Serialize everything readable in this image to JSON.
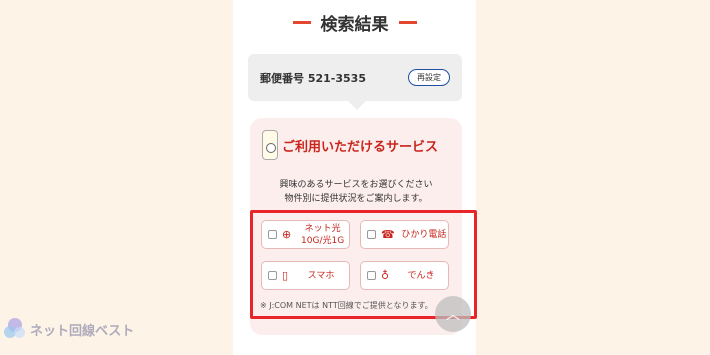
{
  "results": {
    "title": "検索結果"
  },
  "postal": {
    "label": "郵便番号 521-3535",
    "reset_label": "再設定"
  },
  "services": {
    "title": "ご利用いただけるサービス",
    "desc_line1": "興味のあるサービスをお選びください",
    "desc_line2": "物件別に提供状況をご案内します。",
    "options": [
      {
        "label": "ネット光10G/光1G",
        "icon": "globe-icon"
      },
      {
        "label": "ひかり電話",
        "icon": "phone-icon"
      },
      {
        "label": "スマホ",
        "icon": "smartphone-icon"
      },
      {
        "label": "でんき",
        "icon": "lightbulb-icon"
      }
    ],
    "note": "※ J:COM NETは NTT回線でご提供となります。"
  },
  "watermark": {
    "text": "ネット回線ベスト"
  },
  "colors": {
    "accent": "#c8251c",
    "highlight": "#e8262a",
    "postal_button_border": "#1f4ea3"
  }
}
